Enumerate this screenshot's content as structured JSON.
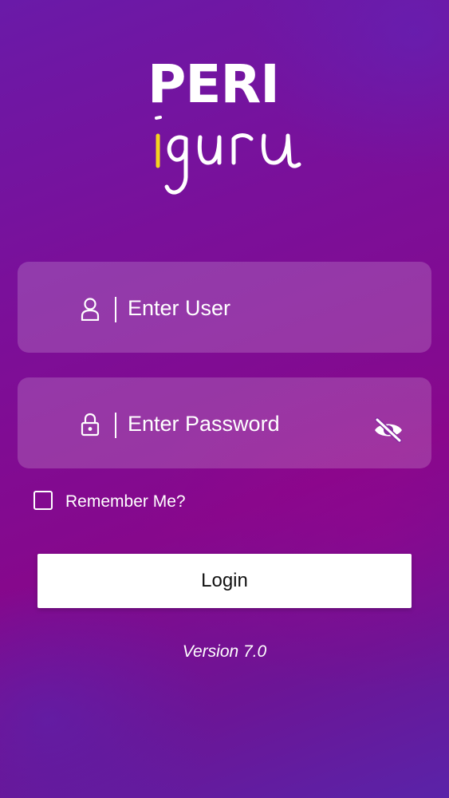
{
  "logo": {
    "line1": "PERI",
    "line2": "iguru",
    "accent_color": "#f5d320"
  },
  "login_form": {
    "user": {
      "placeholder": "Enter User",
      "icon": "user-icon"
    },
    "password": {
      "placeholder": "Enter Password",
      "icon": "lock-icon",
      "toggle_icon": "eye-off-icon"
    },
    "remember_label": "Remember Me?",
    "remember_checked": false,
    "login_label": "Login"
  },
  "footer": {
    "version": "Version 7.0"
  },
  "colors": {
    "background_start": "#6a1aa8",
    "background_mid": "#86088c",
    "field_background": "rgba(255,255,255,0.18)",
    "button_background": "#ffffff"
  }
}
